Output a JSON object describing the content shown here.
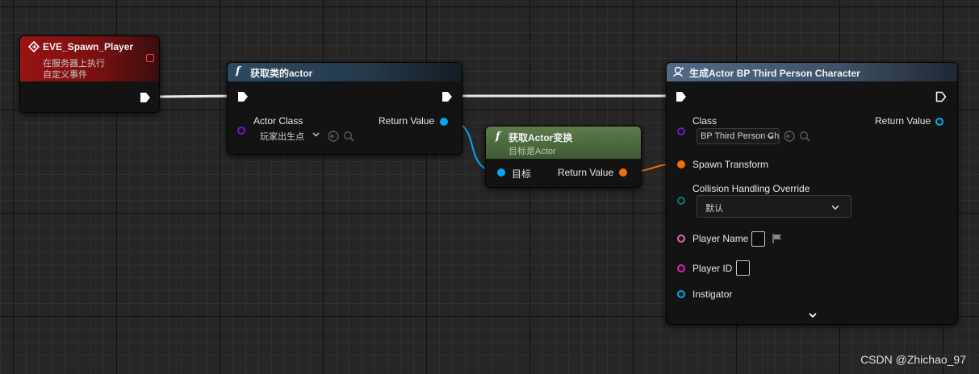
{
  "watermark": "CSDN @Zhichao_97",
  "colors": {
    "exec": "#ffffff",
    "class": "#6a1cc4",
    "object": "#05a8f0",
    "struct": "#f0700f",
    "enum": "#0e7a6b",
    "string": "#e863b5",
    "integer": "#e31ec0",
    "event_header": "#8a1010",
    "function_header": "#2d4a63",
    "pure_header": "#4c6b3c"
  },
  "event_node": {
    "title": "EVE_Spawn_Player",
    "subtitle_1": "在服务器上执行",
    "subtitle_2": "自定义事件",
    "icon": "event-diamond-icon"
  },
  "get_class_node": {
    "title": "获取类的actor",
    "icon": "function-f-icon",
    "in_pin_label": "Actor Class",
    "class_value": "玩家出生点",
    "out_pin_label": "Return Value"
  },
  "get_transform_node": {
    "title": "获取Actor变换",
    "subtitle": "目标是Actor",
    "icon": "function-f-icon",
    "in_pin_label": "目标",
    "out_pin_label": "Return Value"
  },
  "spawn_node": {
    "title": "生成Actor BP Third Person Character",
    "icon": "spawn-actor-icon",
    "class_label": "Class",
    "class_value": "BP Third Person Character",
    "out_pin_label": "Return Value",
    "spawn_transform_label": "Spawn Transform",
    "collision_label": "Collision Handling Override",
    "collision_value": "默认",
    "player_name_label": "Player Name",
    "player_id_label": "Player ID",
    "instigator_label": "Instigator"
  }
}
